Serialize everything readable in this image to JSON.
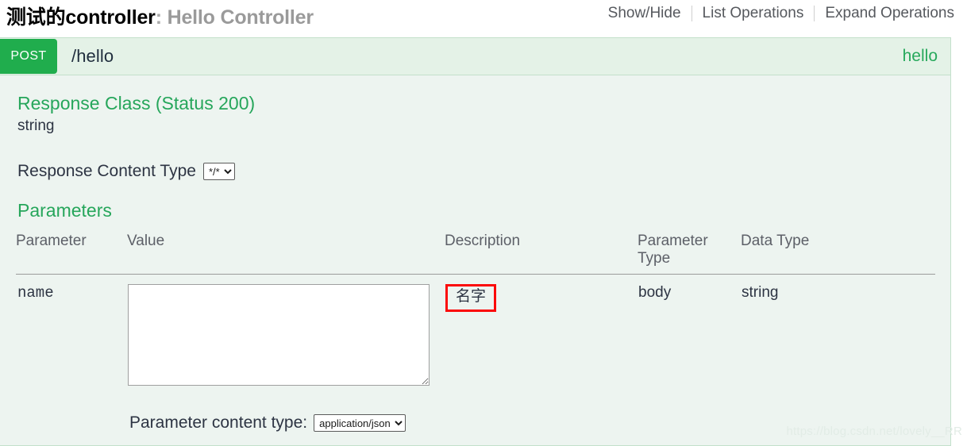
{
  "resource": {
    "tag_name": "测试的controller",
    "separator": ":",
    "tag_description": "Hello Controller",
    "options": [
      {
        "label": "Show/Hide",
        "name": "show-hide"
      },
      {
        "label": "List Operations",
        "name": "list-operations"
      },
      {
        "label": "Expand Operations",
        "name": "expand-operations"
      }
    ]
  },
  "operation": {
    "method": "POST",
    "path": "/hello",
    "summary": "hello",
    "method_color": "#20ad4d",
    "summary_color": "#27a95c",
    "response_class": {
      "heading": "Response Class (Status 200)",
      "model": "string"
    },
    "response_content_type": {
      "label": "Response Content Type",
      "selected": "*/*",
      "options": [
        "*/*"
      ]
    },
    "parameters_heading": "Parameters",
    "table": {
      "headers": {
        "parameter": "Parameter",
        "value": "Value",
        "description": "Description",
        "parameter_type": "Parameter Type",
        "data_type": "Data Type"
      },
      "rows": [
        {
          "parameter": "name",
          "value": "",
          "value_placeholder": "",
          "description": "名字",
          "description_highlight_color": "#fb0909",
          "parameter_type": "body",
          "data_type": "string"
        }
      ]
    },
    "parameter_content_type": {
      "label": "Parameter content type:",
      "selected": "application/json",
      "options": [
        "application/json"
      ]
    }
  },
  "watermark": "https://blog.csdn.net/lovely__RR"
}
